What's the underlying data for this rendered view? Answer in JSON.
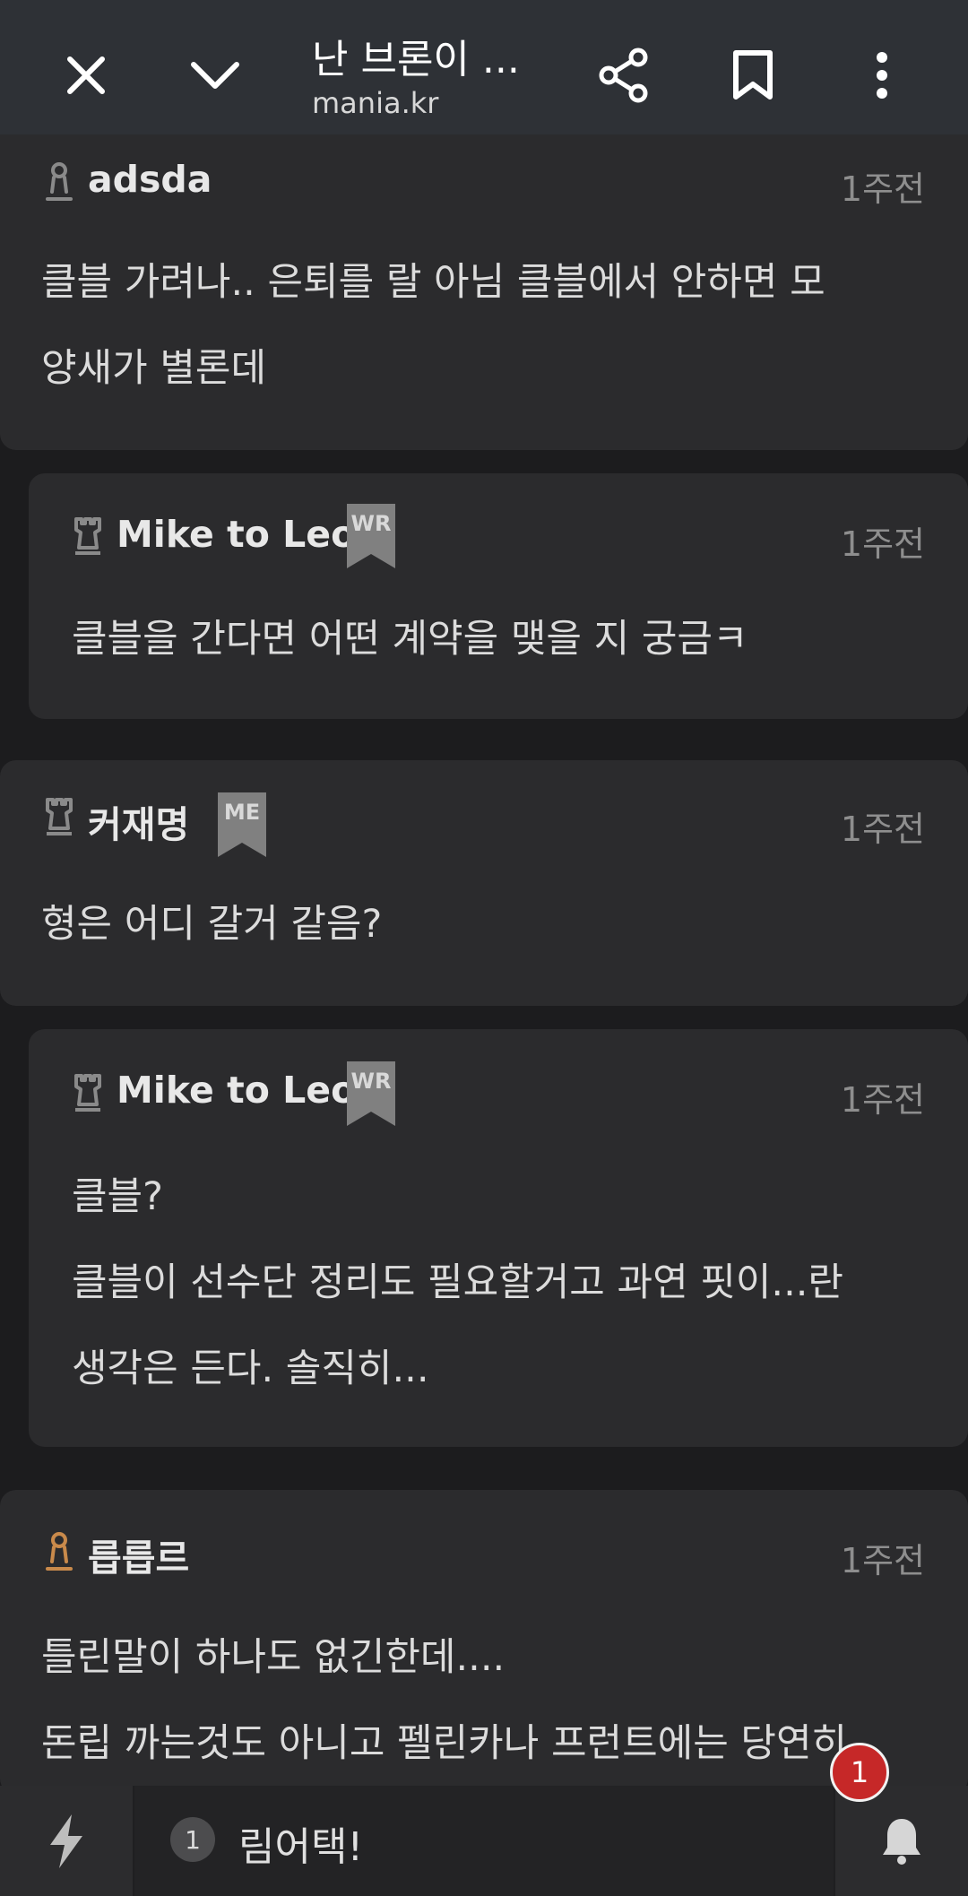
{
  "header": {
    "title": "난 브론이 ...",
    "url": "mania.kr",
    "icons": [
      "close-icon",
      "chevron-down-icon",
      "share-icon",
      "bookmark-icon",
      "more-vert-icon"
    ]
  },
  "comments": [
    {
      "author": "adsda",
      "time": "1주전",
      "lines": [
        "클블 가려나.. 은퇴를 랄 아님 클블에서 안하면 모",
        "양새가 별론데"
      ]
    },
    {
      "author": "Mike to Leo",
      "badge": "WR",
      "time": "1주전",
      "lines": [
        "클블을 간다면 어떤 계약을 맺을 지 궁금ㅋ"
      ]
    },
    {
      "author": "커재명",
      "badge": "ME",
      "time": "1주전",
      "lines": [
        "형은 어디 갈거 같음?"
      ]
    },
    {
      "author": "Mike to Leo",
      "badge": "WR",
      "time": "1주전",
      "lines": [
        "클블?",
        "클블이 선수단 정리도 필요할거고 과연 핏이...란",
        "생각은 든다. 솔직히..."
      ]
    },
    {
      "author": "릅릅르",
      "time": "1주전",
      "lines": [
        "틀린말이 하나도 없긴한데....",
        "돈립 까는것도 아니고 펠린카나 프런트에는 당연히"
      ]
    }
  ],
  "bottom": {
    "count": "1",
    "text": "림어택!",
    "notification_count": "1"
  },
  "colors": {
    "background": "#1c1c1e",
    "card": "#2b2b2d",
    "badge": "#808080",
    "notification": "#c62828",
    "rank_bronze": "#c98a4b"
  }
}
